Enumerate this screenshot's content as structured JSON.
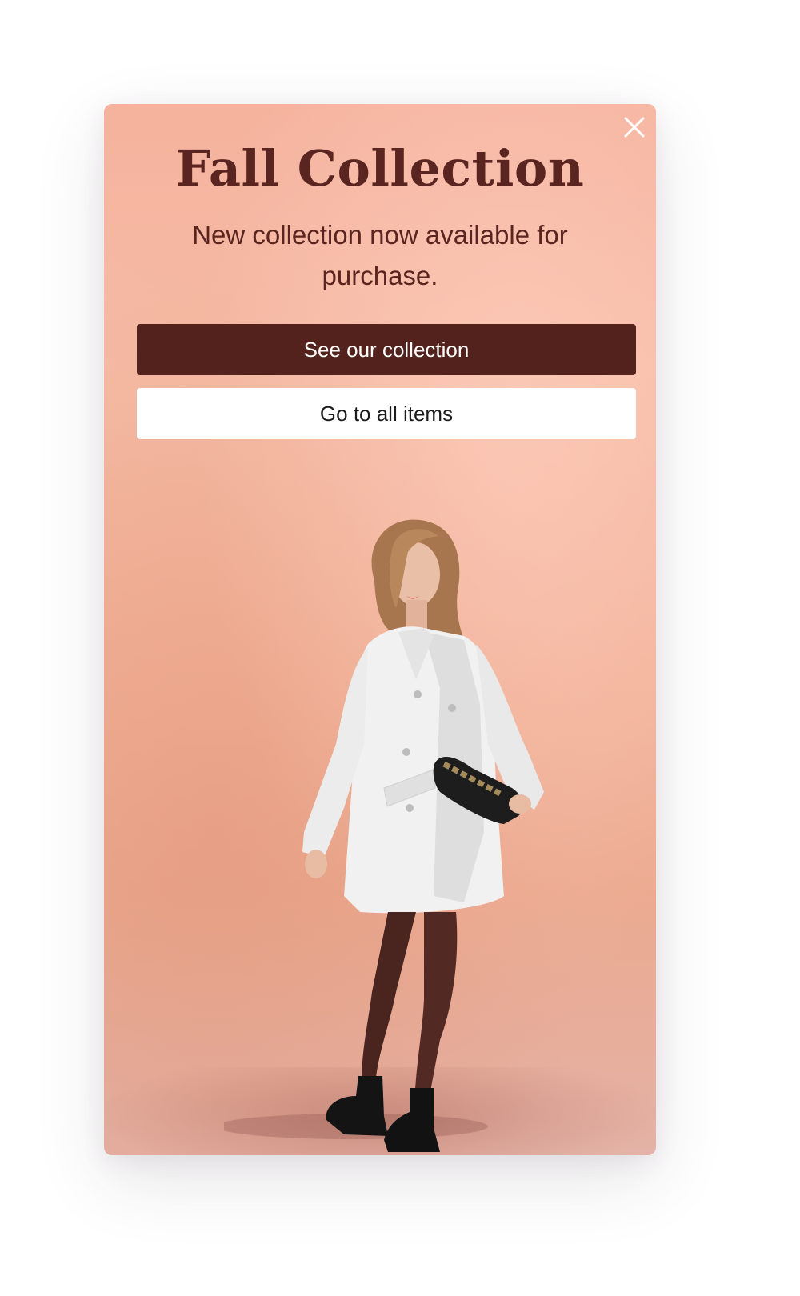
{
  "popup": {
    "title": "Fall Collection",
    "subtitle": "New collection now available for purchase.",
    "primary_button_label": "See our collection",
    "secondary_button_label": "Go to all items",
    "close_icon": "close-icon",
    "image_subject": "woman-in-white-coat-photo"
  },
  "colors": {
    "background_peach": "#f5b29d",
    "title_text": "#5a2520",
    "primary_button_bg": "#54221d",
    "primary_button_text": "#ffffff",
    "secondary_button_bg": "#ffffff",
    "secondary_button_text": "#1c1c1c"
  }
}
